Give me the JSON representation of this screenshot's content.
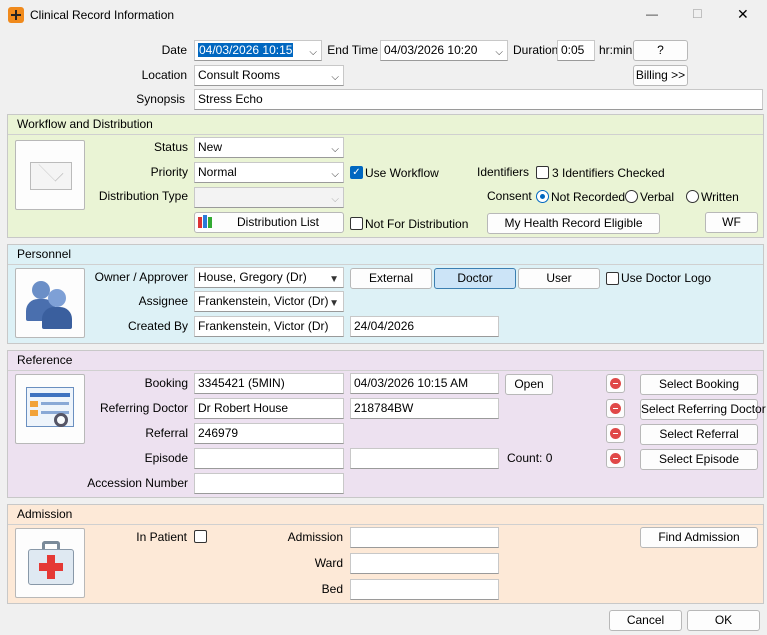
{
  "window": {
    "title": "Clinical Record Information",
    "minimize": "—",
    "maximize": "☐",
    "close": "✕"
  },
  "header": {
    "date_label": "Date",
    "date_value": "04/03/2026  10:15",
    "end_time_label": "End Time",
    "end_time_value": "04/03/2026  10:20",
    "duration_label": "Duration",
    "duration_value": "0:05",
    "duration_unit": "hr:min",
    "help_button": "?",
    "location_label": "Location",
    "location_value": "Consult Rooms",
    "billing_button": "Billing >>",
    "synopsis_label": "Synopsis",
    "synopsis_value": "Stress Echo"
  },
  "workflow": {
    "title": "Workflow and Distribution",
    "status_label": "Status",
    "status_value": "New",
    "priority_label": "Priority",
    "priority_value": "Normal",
    "use_workflow_label": "Use Workflow",
    "identifiers_label": "Identifiers",
    "identifiers_checked_label": "3 Identifiers Checked",
    "consent_label": "Consent",
    "consent_options": [
      "Not Recorded",
      "Verbal",
      "Written"
    ],
    "distribution_type_label": "Distribution Type",
    "distribution_type_value": "",
    "distribution_list_button": "Distribution List",
    "not_for_distribution_label": "Not For Distribution",
    "my_health_button": "My Health Record Eligible",
    "wf_button": "WF"
  },
  "personnel": {
    "title": "Personnel",
    "owner_label": "Owner / Approver",
    "owner_value": "House, Gregory (Dr)",
    "tabs": [
      "External",
      "Doctor",
      "User"
    ],
    "use_doctor_logo_label": "Use Doctor Logo",
    "assignee_label": "Assignee",
    "assignee_value": "Frankenstein, Victor (Dr)",
    "created_by_label": "Created By",
    "created_by_value": "Frankenstein, Victor (Dr)",
    "created_date": "24/04/2026"
  },
  "reference": {
    "title": "Reference",
    "booking_label": "Booking",
    "booking_value": "3345421 (5MIN)",
    "booking_datetime": "04/03/2026 10:15 AM",
    "open_button": "Open",
    "referring_label": "Referring Doctor",
    "referring_value": "Dr Robert House",
    "referring_code": "218784BW",
    "referral_label": "Referral",
    "referral_value": "246979",
    "episode_label": "Episode",
    "episode_value": "",
    "episode_extra": "",
    "count_label": "Count: 0",
    "accession_label": "Accession Number",
    "accession_value": "",
    "select_booking": "Select Booking",
    "select_referring": "Select Referring Doctor",
    "select_referral": "Select Referral",
    "select_episode": "Select Episode"
  },
  "admission": {
    "title": "Admission",
    "in_patient_label": "In Patient",
    "admission_label": "Admission",
    "admission_value": "",
    "ward_label": "Ward",
    "ward_value": "",
    "bed_label": "Bed",
    "bed_value": "",
    "find_button": "Find Admission"
  },
  "footer": {
    "cancel": "Cancel",
    "ok": "OK"
  },
  "colors": {
    "workflow_bg": "#eaf4d5",
    "personnel_bg": "#ddf1f6",
    "reference_bg": "#ede1f0",
    "admission_bg": "#fde9d7",
    "accent": "#0067c0"
  }
}
